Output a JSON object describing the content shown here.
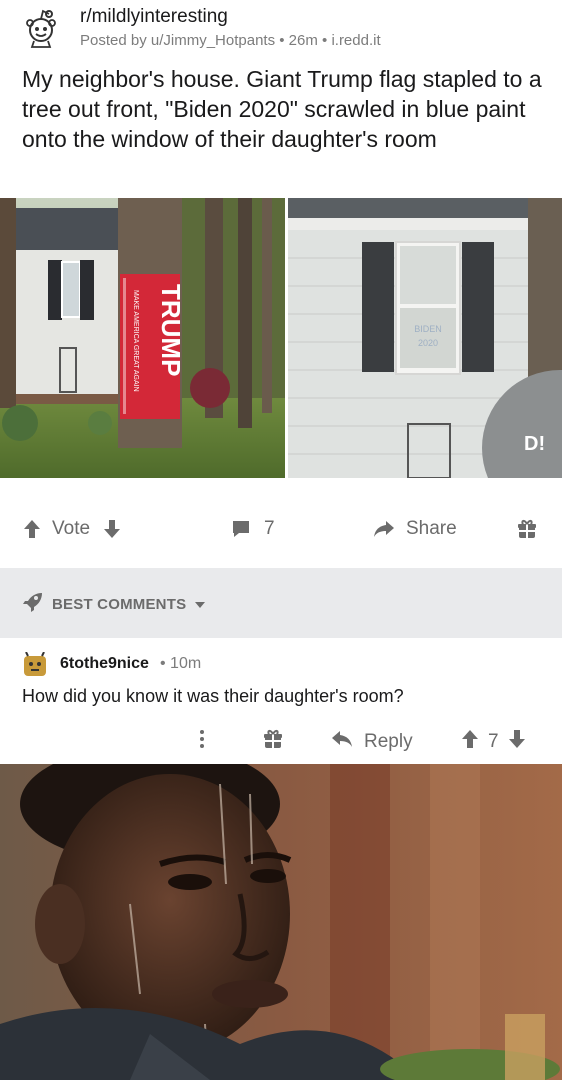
{
  "post": {
    "subreddit": "r/mildlyinteresting",
    "meta": "Posted by u/Jimmy_Hotpants • 26m • i.redd.it",
    "title": "My neighbor's house. Giant Trump flag stapled to a tree out front, \"Biden 2020\" scrawled in blue paint onto the window of their daughter's room",
    "image": {
      "flag_text": "TRUMP",
      "flag_subtext": "MAKE AMERICA GREAT AGAIN",
      "window_text_line1": "BIDEN",
      "window_text_line2": "2020",
      "corner_text": "D!"
    }
  },
  "actions": {
    "vote_label": "Vote",
    "comment_count": "7",
    "share_label": "Share"
  },
  "sort": {
    "label": "BEST COMMENTS"
  },
  "comment": {
    "author": "6tothe9nice",
    "time": "• 10m",
    "body": "How did you know it was their daughter's room?",
    "reply_label": "Reply",
    "score": "7"
  },
  "colors": {
    "text_primary": "#1a1a1b",
    "text_secondary": "#7c7c7c",
    "action_gray": "#6b6b6b",
    "sort_bar_bg": "#e9eaec",
    "flag_red": "#d32838"
  }
}
